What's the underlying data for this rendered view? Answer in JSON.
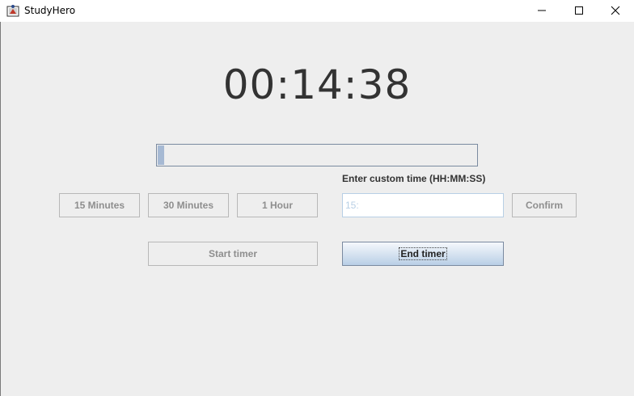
{
  "window": {
    "title": "StudyHero"
  },
  "timer": {
    "display": "00:14:38",
    "progress": 0.02
  },
  "presets": {
    "p15": "15 Minutes",
    "p30": "30 Minutes",
    "p60": "1 Hour"
  },
  "custom": {
    "label": "Enter custom time (HH:MM:SS)",
    "value": "15:",
    "confirm": "Confirm"
  },
  "controls": {
    "start": "Start timer",
    "end": "End timer"
  }
}
